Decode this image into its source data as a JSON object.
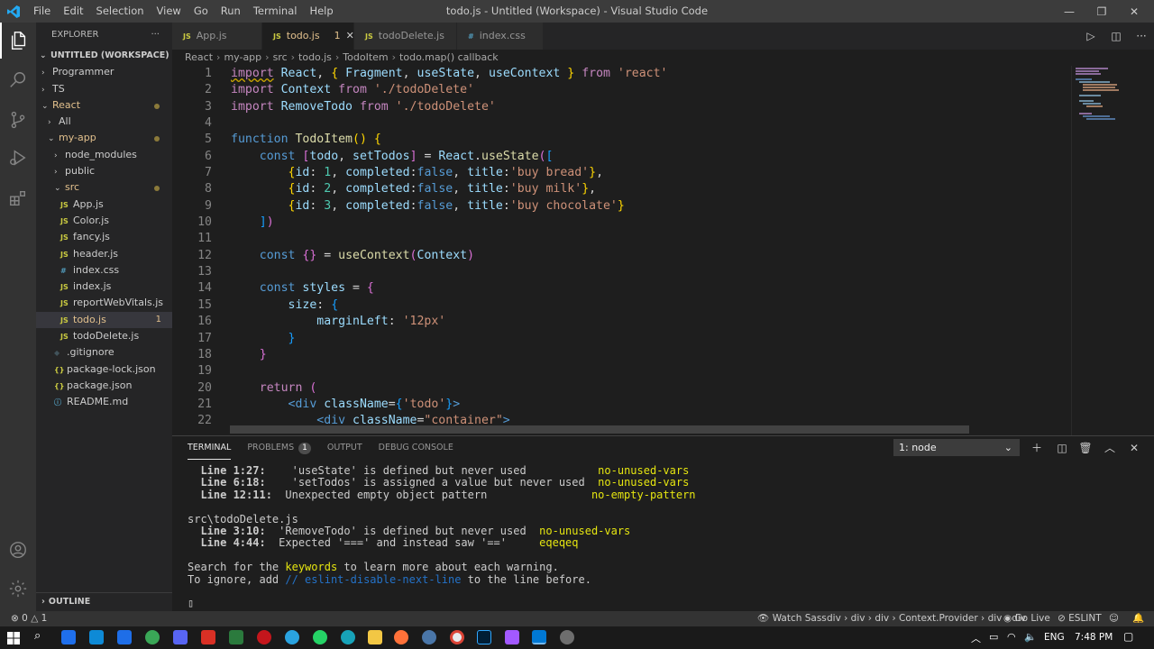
{
  "menu": [
    "File",
    "Edit",
    "Selection",
    "View",
    "Go",
    "Run",
    "Terminal",
    "Help"
  ],
  "window_title": "todo.js - Untitled (Workspace) - Visual Studio Code",
  "explorer": {
    "title": "EXPLORER",
    "more": "···",
    "workspace": "UNTITLED (WORKSPACE)",
    "items": [
      {
        "label": "Programmer",
        "indent": 1,
        "chev": "›"
      },
      {
        "label": "TS",
        "indent": 1,
        "chev": "›"
      },
      {
        "label": "React",
        "indent": 1,
        "chev": "⌄",
        "mod": true,
        "dot": true
      },
      {
        "label": "All",
        "indent": 2,
        "chev": "›"
      },
      {
        "label": "my-app",
        "indent": 2,
        "chev": "⌄",
        "mod": true,
        "dot": true
      },
      {
        "label": "node_modules",
        "indent": 3,
        "chev": "›"
      },
      {
        "label": "public",
        "indent": 3,
        "chev": "›"
      },
      {
        "label": "src",
        "indent": 3,
        "chev": "⌄",
        "mod": true,
        "dot": true
      },
      {
        "label": "App.js",
        "indent": 4,
        "icon": "JS",
        "type": "js"
      },
      {
        "label": "Color.js",
        "indent": 4,
        "icon": "JS",
        "type": "js"
      },
      {
        "label": "fancy.js",
        "indent": 4,
        "icon": "JS",
        "type": "js"
      },
      {
        "label": "header.js",
        "indent": 4,
        "icon": "JS",
        "type": "js"
      },
      {
        "label": "index.css",
        "indent": 4,
        "icon": "#",
        "type": "css"
      },
      {
        "label": "index.js",
        "indent": 4,
        "icon": "JS",
        "type": "js"
      },
      {
        "label": "reportWebVitals.js",
        "indent": 4,
        "icon": "JS",
        "type": "js"
      },
      {
        "label": "todo.js",
        "indent": 4,
        "icon": "JS",
        "type": "js",
        "selected": true,
        "mod": true,
        "badge": "1"
      },
      {
        "label": "todoDelete.js",
        "indent": 4,
        "icon": "JS",
        "type": "js"
      },
      {
        "label": ".gitignore",
        "indent": 3,
        "icon": "◆",
        "type": "git"
      },
      {
        "label": "package-lock.json",
        "indent": 3,
        "icon": "{}",
        "type": "json"
      },
      {
        "label": "package.json",
        "indent": 3,
        "icon": "{}",
        "type": "json"
      },
      {
        "label": "README.md",
        "indent": 3,
        "icon": "ⓘ",
        "type": "md"
      }
    ],
    "outline": "OUTLINE"
  },
  "tabs": [
    {
      "label": "App.js",
      "icon": "JS",
      "active": false
    },
    {
      "label": "todo.js",
      "icon": "JS",
      "active": true,
      "badge": "1",
      "close": "✕"
    },
    {
      "label": "todoDelete.js",
      "icon": "JS",
      "active": false
    },
    {
      "label": "index.css",
      "icon": "#",
      "active": false
    }
  ],
  "breadcrumb": [
    "React",
    "my-app",
    "src",
    "todo.js",
    "TodoItem",
    "todo.map() callback"
  ],
  "editor": {
    "lines": [
      [
        [
          "kw",
          "import"
        ],
        [
          "tx",
          " "
        ],
        [
          "va",
          "React"
        ],
        [
          "tx",
          ", "
        ],
        [
          "br1",
          "{"
        ],
        [
          "tx",
          " "
        ],
        [
          "va",
          "Fragment"
        ],
        [
          "tx",
          ", "
        ],
        [
          "va",
          "useState"
        ],
        [
          "tx",
          ", "
        ],
        [
          "va",
          "useContext"
        ],
        [
          "tx",
          " "
        ],
        [
          "br1",
          "}"
        ],
        [
          "tx",
          " "
        ],
        [
          "kw",
          "from"
        ],
        [
          "tx",
          " "
        ],
        [
          "st",
          "'react'"
        ]
      ],
      [
        [
          "kw",
          "import"
        ],
        [
          "tx",
          " "
        ],
        [
          "va",
          "Context"
        ],
        [
          "tx",
          " "
        ],
        [
          "kw",
          "from"
        ],
        [
          "tx",
          " "
        ],
        [
          "st",
          "'./todoDelete'"
        ]
      ],
      [
        [
          "kw",
          "import"
        ],
        [
          "tx",
          " "
        ],
        [
          "va",
          "RemoveTodo"
        ],
        [
          "tx",
          " "
        ],
        [
          "kw",
          "from"
        ],
        [
          "tx",
          " "
        ],
        [
          "st",
          "'./todoDelete'"
        ]
      ],
      [],
      [
        [
          "sk",
          "function"
        ],
        [
          "tx",
          " "
        ],
        [
          "fn",
          "TodoItem"
        ],
        [
          "br1",
          "()"
        ],
        [
          "tx",
          " "
        ],
        [
          "br1",
          "{"
        ]
      ],
      [
        [
          "tx",
          "    "
        ],
        [
          "sk",
          "const"
        ],
        [
          "tx",
          " "
        ],
        [
          "br2",
          "["
        ],
        [
          "va",
          "todo"
        ],
        [
          "tx",
          ", "
        ],
        [
          "va",
          "setTodos"
        ],
        [
          "br2",
          "]"
        ],
        [
          "tx",
          " = "
        ],
        [
          "va",
          "React"
        ],
        [
          "tx",
          "."
        ],
        [
          "fn",
          "useState"
        ],
        [
          "br2",
          "("
        ],
        [
          "br3",
          "["
        ]
      ],
      [
        [
          "tx",
          "        "
        ],
        [
          "br1",
          "{"
        ],
        [
          "va",
          "id"
        ],
        [
          "tx",
          ": "
        ],
        [
          "ty",
          "1"
        ],
        [
          "tx",
          ", "
        ],
        [
          "va",
          "completed"
        ],
        [
          "tx",
          ":"
        ],
        [
          "sk",
          "false"
        ],
        [
          "tx",
          ", "
        ],
        [
          "va",
          "title"
        ],
        [
          "tx",
          ":"
        ],
        [
          "st",
          "'buy bread'"
        ],
        [
          "br1",
          "}"
        ],
        [
          "tx",
          ","
        ]
      ],
      [
        [
          "tx",
          "        "
        ],
        [
          "br1",
          "{"
        ],
        [
          "va",
          "id"
        ],
        [
          "tx",
          ": "
        ],
        [
          "ty",
          "2"
        ],
        [
          "tx",
          ", "
        ],
        [
          "va",
          "completed"
        ],
        [
          "tx",
          ":"
        ],
        [
          "sk",
          "false"
        ],
        [
          "tx",
          ", "
        ],
        [
          "va",
          "title"
        ],
        [
          "tx",
          ":"
        ],
        [
          "st",
          "'buy milk'"
        ],
        [
          "br1",
          "}"
        ],
        [
          "tx",
          ","
        ]
      ],
      [
        [
          "tx",
          "        "
        ],
        [
          "br1",
          "{"
        ],
        [
          "va",
          "id"
        ],
        [
          "tx",
          ": "
        ],
        [
          "ty",
          "3"
        ],
        [
          "tx",
          ", "
        ],
        [
          "va",
          "completed"
        ],
        [
          "tx",
          ":"
        ],
        [
          "sk",
          "false"
        ],
        [
          "tx",
          ", "
        ],
        [
          "va",
          "title"
        ],
        [
          "tx",
          ":"
        ],
        [
          "st",
          "'buy chocolate'"
        ],
        [
          "br1",
          "}"
        ]
      ],
      [
        [
          "tx",
          "    "
        ],
        [
          "br3",
          "]"
        ],
        [
          "br2",
          ")"
        ]
      ],
      [],
      [
        [
          "tx",
          "    "
        ],
        [
          "sk",
          "const"
        ],
        [
          "tx",
          " "
        ],
        [
          "br2",
          "{}"
        ],
        [
          "tx",
          " = "
        ],
        [
          "fn",
          "useContext"
        ],
        [
          "br2",
          "("
        ],
        [
          "va",
          "Context"
        ],
        [
          "br2",
          ")"
        ]
      ],
      [],
      [
        [
          "tx",
          "    "
        ],
        [
          "sk",
          "const"
        ],
        [
          "tx",
          " "
        ],
        [
          "va",
          "styles"
        ],
        [
          "tx",
          " = "
        ],
        [
          "br2",
          "{"
        ]
      ],
      [
        [
          "tx",
          "        "
        ],
        [
          "va",
          "size"
        ],
        [
          "tx",
          ": "
        ],
        [
          "br3",
          "{"
        ]
      ],
      [
        [
          "tx",
          "            "
        ],
        [
          "va",
          "marginLeft"
        ],
        [
          "tx",
          ": "
        ],
        [
          "st",
          "'12px'"
        ]
      ],
      [
        [
          "tx",
          "        "
        ],
        [
          "br3",
          "}"
        ]
      ],
      [
        [
          "tx",
          "    "
        ],
        [
          "br2",
          "}"
        ]
      ],
      [],
      [
        [
          "tx",
          "    "
        ],
        [
          "kw",
          "return"
        ],
        [
          "tx",
          " "
        ],
        [
          "br2",
          "("
        ]
      ],
      [
        [
          "tx",
          "        "
        ],
        [
          "sk",
          "<div"
        ],
        [
          "tx",
          " "
        ],
        [
          "va",
          "className"
        ],
        [
          "tx",
          "="
        ],
        [
          "br3",
          "{"
        ],
        [
          "st",
          "'todo'"
        ],
        [
          "br3",
          "}"
        ],
        [
          "sk",
          ">"
        ]
      ],
      [
        [
          "tx",
          "            "
        ],
        [
          "sk",
          "<div"
        ],
        [
          "tx",
          " "
        ],
        [
          "va",
          "className"
        ],
        [
          "tx",
          "="
        ],
        [
          "st",
          "\"container\""
        ],
        [
          "sk",
          ">"
        ]
      ]
    ]
  },
  "panel": {
    "tabs": [
      {
        "label": "TERMINAL",
        "active": true
      },
      {
        "label": "PROBLEMS",
        "badge": "1"
      },
      {
        "label": "OUTPUT"
      },
      {
        "label": "DEBUG CONSOLE"
      }
    ],
    "terminal_select": "1: node",
    "terminal_lines": [
      [
        [
          "b",
          "  Line 1:27:  "
        ],
        [
          "n",
          "  'useState' is defined but never used           "
        ],
        [
          "y",
          "no-unused-vars"
        ]
      ],
      [
        [
          "b",
          "  Line 6:18:  "
        ],
        [
          "n",
          "  'setTodos' is assigned a value but never used  "
        ],
        [
          "y",
          "no-unused-vars"
        ]
      ],
      [
        [
          "b",
          "  Line 12:11: "
        ],
        [
          "n",
          " Unexpected empty object pattern                "
        ],
        [
          "y",
          "no-empty-pattern"
        ]
      ],
      [
        [
          "n",
          ""
        ]
      ],
      [
        [
          "n",
          "src\\todoDelete.js"
        ]
      ],
      [
        [
          "b",
          "  Line 3:10: "
        ],
        [
          "n",
          " 'RemoveTodo' is defined but never used  "
        ],
        [
          "y",
          "no-unused-vars"
        ]
      ],
      [
        [
          "b",
          "  Line 4:44: "
        ],
        [
          "n",
          " Expected '===' and instead saw '=='     "
        ],
        [
          "y",
          "eqeqeq"
        ]
      ],
      [
        [
          "n",
          ""
        ]
      ],
      [
        [
          "n",
          "Search for the "
        ],
        [
          "y",
          "keywords"
        ],
        [
          "n",
          " to learn more about each warning."
        ]
      ],
      [
        [
          "n",
          "To ignore, add "
        ],
        [
          "u",
          "// eslint-disable-next-line"
        ],
        [
          "n",
          " to the line before."
        ]
      ],
      [
        [
          "n",
          ""
        ]
      ],
      [
        [
          "n",
          "▯"
        ]
      ]
    ]
  },
  "status": {
    "errors": "0",
    "warnings": "1",
    "watch_sass": "Watch Sass",
    "crumbs": "div › div › div › Context.Provider › div › div",
    "go_live": "Go Live",
    "eslint": "ESLINT"
  },
  "taskbar": {
    "lang": "ENG",
    "time": "7:48 PM"
  }
}
